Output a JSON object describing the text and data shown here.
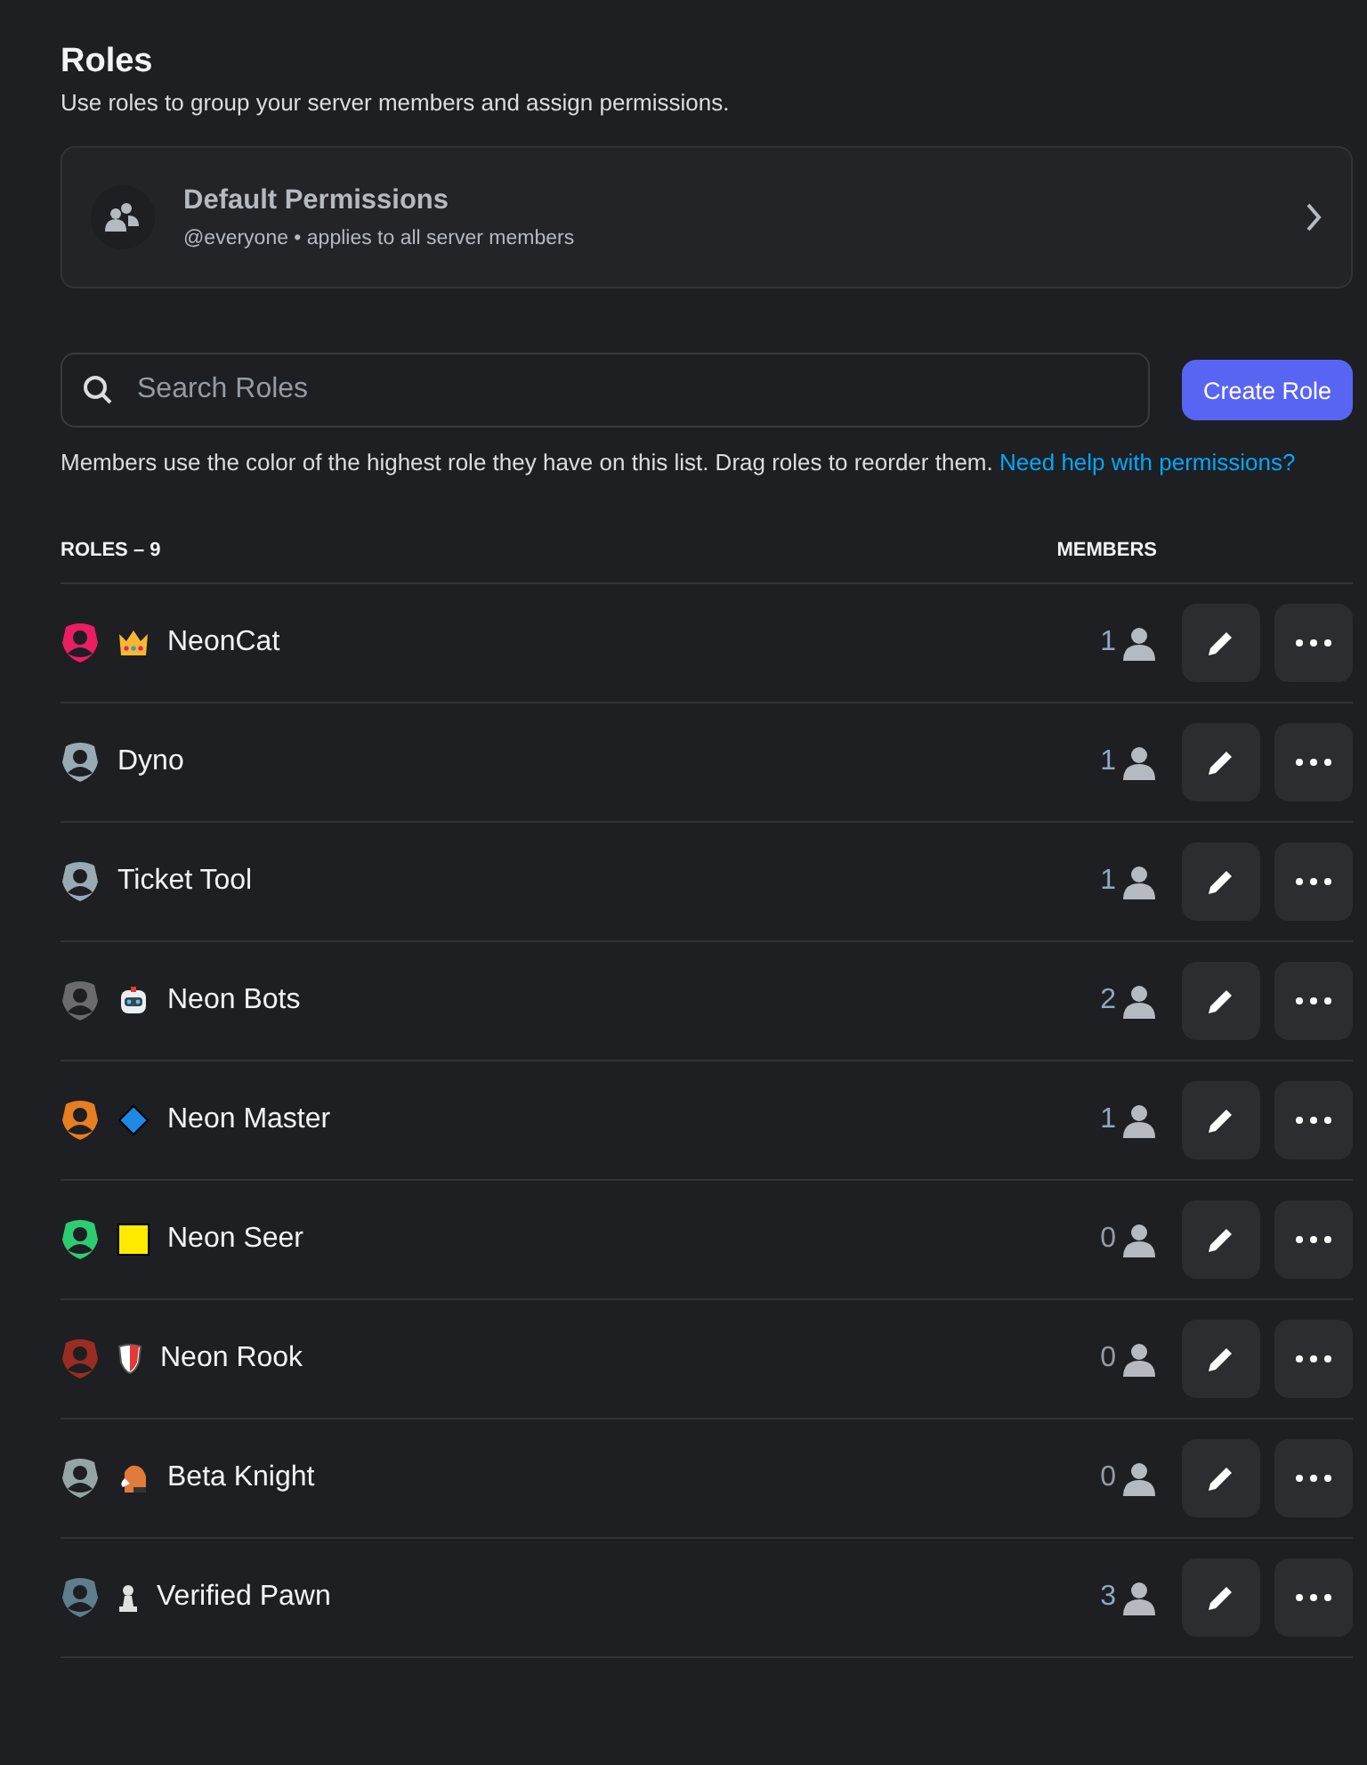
{
  "header": {
    "title": "Roles",
    "subtitle": "Use roles to group your server members and assign permissions."
  },
  "default_permissions": {
    "title": "Default Permissions",
    "subtitle": "@everyone • applies to all server members"
  },
  "search": {
    "placeholder": "Search Roles"
  },
  "create_button": "Create Role",
  "help": {
    "text": "Members use the color of the highest role they have on this list. Drag roles to reorder them.",
    "link": "Need help with permissions?"
  },
  "table": {
    "columns": [
      "ROLES – 9",
      "MEMBERS"
    ],
    "rows": [
      {
        "name": "NeonCat",
        "color": "#e91e63",
        "kind": "crown",
        "members": "1"
      },
      {
        "name": "Dyno",
        "color": "#99aab5",
        "kind": "plain",
        "members": "1"
      },
      {
        "name": "Ticket Tool",
        "color": "#99aab5",
        "kind": "plain",
        "members": "1"
      },
      {
        "name": "Neon Bots",
        "color": "#6b6b6f",
        "kind": "robot",
        "members": "2"
      },
      {
        "name": "Neon Master",
        "color": "#e67e22",
        "kind": "diamond",
        "members": "1"
      },
      {
        "name": "Neon Seer",
        "color": "#2ecc71",
        "kind": "square",
        "members": "0"
      },
      {
        "name": "Neon Rook",
        "color": "#992d22",
        "kind": "shield",
        "members": "0"
      },
      {
        "name": "Beta Knight",
        "color": "#95a5a6",
        "kind": "horse",
        "members": "0"
      },
      {
        "name": "Verified Pawn",
        "color": "#607d8b",
        "kind": "pawn",
        "members": "3"
      }
    ]
  }
}
